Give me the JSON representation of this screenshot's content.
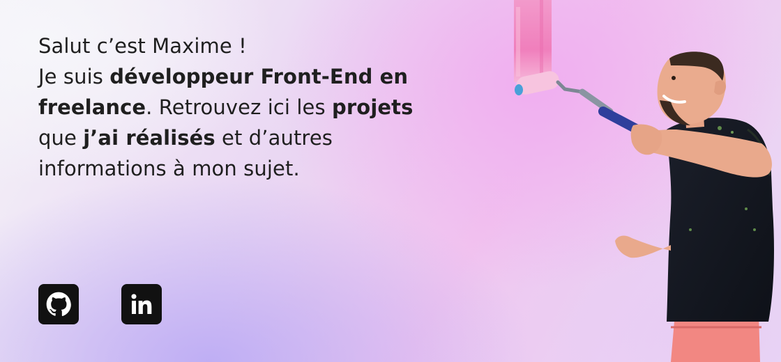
{
  "intro": {
    "line1": "Salut c’est Maxime !",
    "p1": "Je suis ",
    "b1": "développeur Front-End en freelance",
    "p2": ". Retrouvez ici les ",
    "b2": "projets",
    "p3": " que ",
    "b3": "j’ai réalisés",
    "p4": " et d’autres informations à mon sujet."
  },
  "social_links": [
    {
      "name": "GitHub",
      "icon": "github-icon"
    },
    {
      "name": "LinkedIn",
      "icon": "linkedin-icon"
    }
  ],
  "colors": {
    "icon_bg": "#111111",
    "paint_pink": "#f08cc4",
    "roller_handle_blue": "#2f3f9c"
  }
}
